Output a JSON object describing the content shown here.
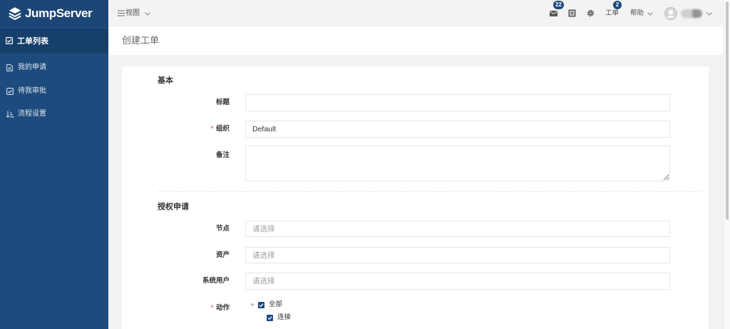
{
  "brand": {
    "name": "JumpServer",
    "logo_icon": "jumpserver-logo-icon"
  },
  "colors": {
    "sidebar": "#1d4b7d",
    "sidebar_header": "#1b4676",
    "sidebar_active": "#173f6b",
    "badge": "#1b4a7d",
    "required": "#ed5565",
    "checkbox": "#1c4b80",
    "page_bg": "#f3f3f4"
  },
  "sidebar": {
    "active": {
      "label": "工单列表",
      "icon": "check-square-icon"
    },
    "items": [
      {
        "label": "我的申请",
        "icon": "file-text-icon"
      },
      {
        "label": "待我审批",
        "icon": "check-square-icon"
      },
      {
        "label": "流程设置",
        "icon": "sort-icon"
      }
    ]
  },
  "topbar": {
    "menu_icon": "bars-icon",
    "view_label": "视图",
    "messages": {
      "icon": "envelope-icon",
      "badge": "22"
    },
    "terminal": {
      "icon": "web-terminal-icon"
    },
    "settings": {
      "icon": "gear-icon"
    },
    "tickets": {
      "label": "工单",
      "badge": "2"
    },
    "help": {
      "label": "帮助"
    },
    "user": {
      "avatar_icon": "user-avatar-icon"
    }
  },
  "page": {
    "title": "创建工单"
  },
  "form": {
    "required_mark": "*",
    "basic": {
      "heading": "基本",
      "title_label": "标题",
      "org_label": "组织",
      "org_value": "Default",
      "comment_label": "备注"
    },
    "apply": {
      "heading": "授权申请",
      "nodes_label": "节点",
      "nodes_placeholder": "请选择",
      "assets_label": "资产",
      "assets_placeholder": "请选择",
      "system_users_label": "系统用户",
      "system_users_placeholder": "请选择",
      "actions_label": "动作",
      "actions_tree": [
        {
          "label": "全部",
          "checked": true,
          "expanded": true
        },
        {
          "label": "连接",
          "checked": true
        }
      ]
    }
  }
}
